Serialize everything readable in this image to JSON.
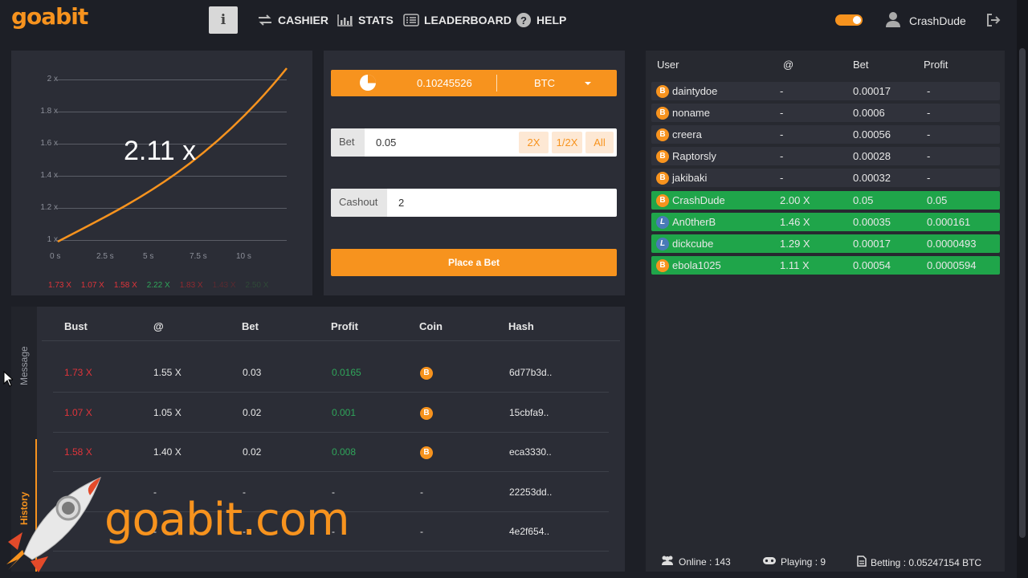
{
  "brand": {
    "logo_text": "goabit"
  },
  "nav": {
    "info_label": "i",
    "items": [
      {
        "label": "CASHIER",
        "icon": "transfer-icon"
      },
      {
        "label": "STATS",
        "icon": "bar-chart-icon"
      },
      {
        "label": "LEADERBOARD",
        "icon": "list-icon"
      },
      {
        "label": "HELP",
        "icon": "question-icon"
      }
    ],
    "username": "CrashDude"
  },
  "graph": {
    "current_multiplier": "2.11 x",
    "y_ticks": [
      "2 x",
      "1.8 x",
      "1.6 x",
      "1.4 x",
      "1.2 x",
      "1 x"
    ],
    "x_ticks": [
      "0 s",
      "2.5 s",
      "5 s",
      "7.5 s",
      "10 s"
    ],
    "recent_busts": [
      {
        "value": "1.73 X",
        "color": "#e0343a"
      },
      {
        "value": "1.07 X",
        "color": "#e0343a"
      },
      {
        "value": "1.58 X",
        "color": "#e0343a"
      },
      {
        "value": "2.22 X",
        "color": "#2fa55a"
      },
      {
        "value": "1.83 X",
        "color": "#8f2a30"
      },
      {
        "value": "1.43 X",
        "color": "#5a2a30"
      },
      {
        "value": "2.50 X",
        "color": "#2f4a38"
      }
    ]
  },
  "bet_form": {
    "balance": "0.10245526",
    "currency": "BTC",
    "bet_label": "Bet",
    "bet_value": "0.05",
    "double_label": "2X",
    "half_label": "1/2X",
    "all_label": "All",
    "cashout_label": "Cashout",
    "cashout_value": "2",
    "place_bet_label": "Place a Bet"
  },
  "history": {
    "tabs": {
      "message": "Message",
      "history": "History"
    },
    "columns": [
      "Bust",
      "@",
      "Bet",
      "Profit",
      "Coin",
      "Hash"
    ],
    "rows": [
      {
        "bust": "1.73 X",
        "at": "1.55 X",
        "bet": "0.03",
        "profit": "0.0165",
        "coin": "B",
        "hash": "6d77b3d.."
      },
      {
        "bust": "1.07 X",
        "at": "1.05 X",
        "bet": "0.02",
        "profit": "0.001",
        "coin": "B",
        "hash": "15cbfa9.."
      },
      {
        "bust": "1.58 X",
        "at": "1.40 X",
        "bet": "0.02",
        "profit": "0.008",
        "coin": "B",
        "hash": "eca3330.."
      },
      {
        "bust": "",
        "at": "-",
        "bet": "-",
        "profit": "-",
        "coin": "-",
        "hash": "22253dd.."
      },
      {
        "bust": "",
        "at": "-",
        "bet": "-",
        "profit": "-",
        "coin": "-",
        "hash": "4e2f654.."
      }
    ],
    "colors": {
      "bust": "#e0343a",
      "profit": "#2fa55a"
    }
  },
  "watermark": {
    "text": "goabit.com"
  },
  "players": {
    "columns": [
      "User",
      "@",
      "Bet",
      "Profit"
    ],
    "rows": [
      {
        "coin": "B",
        "user": "daintydoe",
        "at": "-",
        "bet": "0.00017",
        "profit": "-",
        "win": false
      },
      {
        "coin": "B",
        "user": "noname",
        "at": "-",
        "bet": "0.0006",
        "profit": "-",
        "win": false
      },
      {
        "coin": "B",
        "user": "creera",
        "at": "-",
        "bet": "0.00056",
        "profit": "-",
        "win": false
      },
      {
        "coin": "B",
        "user": "Raptorsly",
        "at": "-",
        "bet": "0.00028",
        "profit": "-",
        "win": false
      },
      {
        "coin": "B",
        "user": "jakibaki",
        "at": "-",
        "bet": "0.00032",
        "profit": "-",
        "win": false
      },
      {
        "coin": "B",
        "user": "CrashDude",
        "at": "2.00 X",
        "bet": "0.05",
        "profit": "0.05",
        "win": true
      },
      {
        "coin": "L",
        "user": "An0therB",
        "at": "1.46 X",
        "bet": "0.00035",
        "profit": "0.000161",
        "win": true
      },
      {
        "coin": "L",
        "user": "dickcube",
        "at": "1.29 X",
        "bet": "0.00017",
        "profit": "0.0000493",
        "win": true
      },
      {
        "coin": "B",
        "user": "ebola1025",
        "at": "1.11 X",
        "bet": "0.00054",
        "profit": "0.0000594",
        "win": true
      }
    ],
    "footer": {
      "online": "Online : 143",
      "playing": "Playing : 9",
      "betting": "Betting : 0.05247154 BTC"
    }
  }
}
